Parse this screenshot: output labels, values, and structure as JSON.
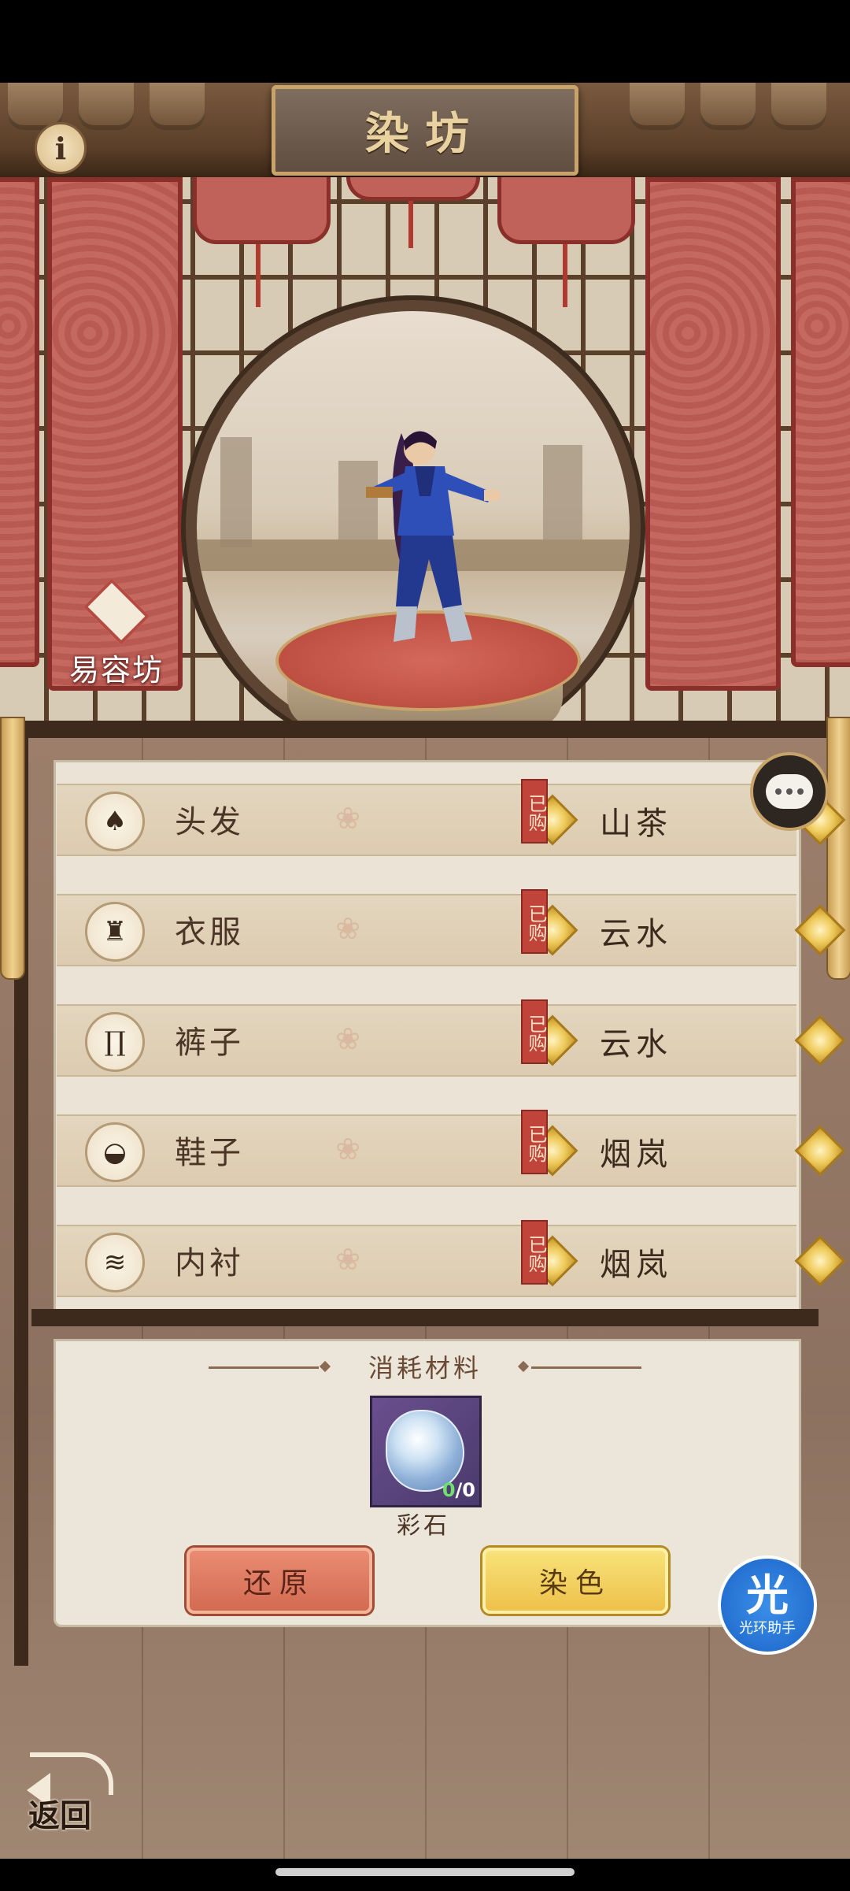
{
  "header": {
    "title": "染坊",
    "info_icon": "info-icon"
  },
  "side_menu": {
    "dressing_room_label": "易容坊",
    "dressing_room_icon": "mask-diamond-icon"
  },
  "dye_slots": [
    {
      "part": "头发",
      "icon": "hair-icon",
      "status": "已购",
      "color_name": "山茶"
    },
    {
      "part": "衣服",
      "icon": "clothes-icon",
      "status": "已购",
      "color_name": "云水"
    },
    {
      "part": "裤子",
      "icon": "pants-icon",
      "status": "已购",
      "color_name": "云水"
    },
    {
      "part": "鞋子",
      "icon": "shoes-icon",
      "status": "已购",
      "color_name": "烟岚"
    },
    {
      "part": "内衬",
      "icon": "lining-icon",
      "status": "已购",
      "color_name": "烟岚"
    }
  ],
  "materials": {
    "title": "消耗材料",
    "item_name": "彩石",
    "have": "0",
    "need": "/0",
    "icon": "gem-icon"
  },
  "actions": {
    "restore_label": "还原",
    "dye_label": "染色"
  },
  "assistant": {
    "glyph": "光",
    "label": "光环助手"
  },
  "footer": {
    "back_label": "返回"
  },
  "colors": {
    "accent_gold": "#eec14a",
    "accent_red": "#d26b52",
    "curtain_red": "#c5685f"
  }
}
